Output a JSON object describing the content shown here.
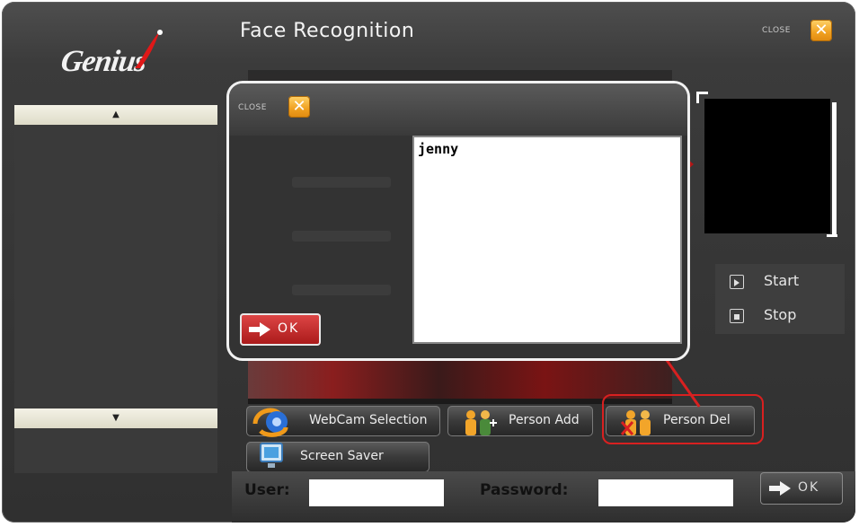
{
  "app": {
    "logo_text": "Genius",
    "title": "Face Recognition"
  },
  "window_close": {
    "label": "CLOSE",
    "icon": "close-x-icon"
  },
  "left_panel": {
    "up_arrow": "▲",
    "down_arrow": "▼"
  },
  "controls": {
    "start_label": "Start",
    "stop_label": "Stop"
  },
  "buttons": {
    "webcam": "WebCam Selection",
    "person_add": "Person Add",
    "person_del": "Person Del",
    "screen_saver": "Screen Saver"
  },
  "login": {
    "user_label": "User:",
    "user_value": "",
    "password_label": "Password:",
    "password_value": "",
    "ok_label": "OK"
  },
  "dialog": {
    "close_label": "CLOSE",
    "ok_label": "OK",
    "persons": [
      "jenny"
    ]
  },
  "colors": {
    "accent_orange": "#f0a020",
    "highlight_red": "#d82020",
    "ok_red": "#c62a2a"
  }
}
